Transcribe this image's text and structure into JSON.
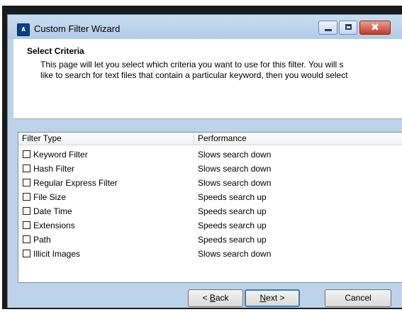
{
  "window": {
    "title": "Custom Filter Wizard"
  },
  "header": {
    "title": "Select Criteria",
    "line1": "This page will let you select which criteria you want to use for this filter.  You will s",
    "line2": "like to search for text files that contain a particular keyword, then you would select"
  },
  "list": {
    "columns": [
      "Filter Type",
      "Performance"
    ],
    "rows": [
      {
        "name": "Keyword Filter",
        "performance": "Slows search down",
        "checked": false
      },
      {
        "name": "Hash Filter",
        "performance": "Slows search down",
        "checked": false
      },
      {
        "name": "Regular Express Filter",
        "performance": "Slows search down",
        "checked": false
      },
      {
        "name": "File Size",
        "performance": "Speeds search up",
        "checked": false
      },
      {
        "name": "Date Time",
        "performance": "Speeds search up",
        "checked": false
      },
      {
        "name": "Extensions",
        "performance": "Speeds search up",
        "checked": false
      },
      {
        "name": "Path",
        "performance": "Speeds search up",
        "checked": false
      },
      {
        "name": "Illicit Images",
        "performance": "Slows search down",
        "checked": false
      }
    ]
  },
  "buttons": {
    "back_accel": "B",
    "back_rest": "ack",
    "back_prefix": "< ",
    "next_accel": "N",
    "next_rest": "ext >",
    "cancel": "Cancel"
  },
  "icons": {
    "app": "app-logo-icon",
    "minimize": "minimize-icon",
    "maximize": "maximize-icon",
    "close": "close-icon"
  },
  "colors": {
    "close_button": "#c0392b",
    "title_bar": "#bcd3ea",
    "default_button_border": "#3c7fb1"
  }
}
